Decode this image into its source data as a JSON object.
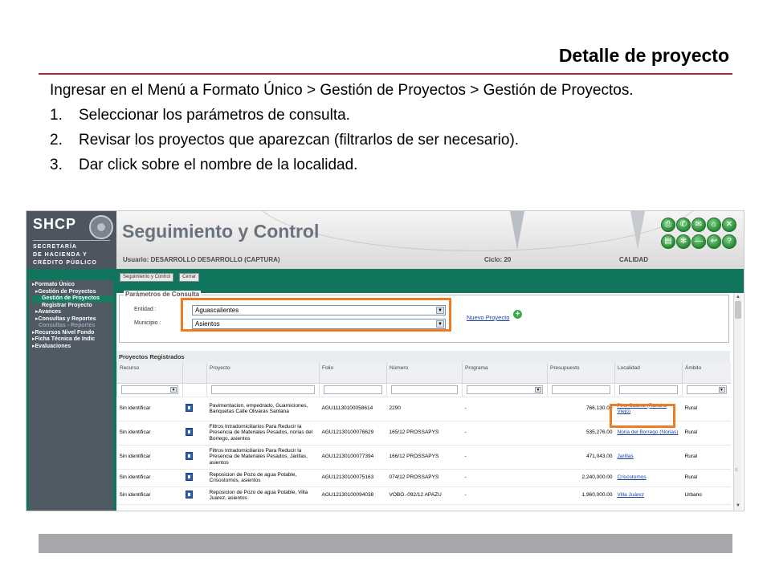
{
  "slide": {
    "title": "Detalle de proyecto",
    "intro": "Ingresar en el Menú a Formato Único > Gestión de Proyectos > Gestión de Proyectos.",
    "steps": [
      {
        "num": "1.",
        "text": "Seleccionar los parámetros de consulta."
      },
      {
        "num": "2.",
        "text": "Revisar los proyectos que aparezcan (filtrarlos de ser necesario)."
      },
      {
        "num": "3.",
        "text": "Dar click sobre el nombre de la localidad."
      }
    ]
  },
  "app": {
    "logo": "SHCP",
    "org_line1": "SECRETARÍA",
    "org_line2": "DE HACIENDA Y",
    "org_line3": "CRÉDITO PÚBLICO",
    "title": "Seguimiento y Control",
    "user": "Usuario: DESARROLLO DESARROLLO (CAPTURA)",
    "cycle": "Ciclo: 20",
    "quality": "CALIDAD",
    "header_icons": [
      "print-icon",
      "phone-icon",
      "mail-icon",
      "home-icon",
      "close-icon",
      "folder-icon",
      "tools-icon",
      "minus-icon",
      "back-icon",
      "help-icon"
    ],
    "tabs": {
      "main": "Seguimiento y Control",
      "close": "Cerrar"
    }
  },
  "sidebar": {
    "items": [
      {
        "label": "Formato Único",
        "level": 0
      },
      {
        "label": "Gestión de Proyectos",
        "level": 1
      },
      {
        "label": "Gestión de Proyectos",
        "level": 2,
        "selected": true
      },
      {
        "label": "Registrar Proyecto",
        "level": 2
      },
      {
        "label": "Avances",
        "level": 1
      },
      {
        "label": "Consultas y Reportes",
        "level": 1
      },
      {
        "label": "Consultas - Reportes",
        "level": 1,
        "dim": true
      },
      {
        "label": "Recursos Nivel Fondo",
        "level": 0
      },
      {
        "label": "Ficha Técnica de Indic",
        "level": 0
      },
      {
        "label": "Evaluaciones",
        "level": 0
      }
    ]
  },
  "params": {
    "title": "Parámetros de Consulta",
    "entidad_label": "Entidad :",
    "entidad_value": "Aguascalientes",
    "municipio_label": "Municipio :",
    "municipio_value": "Asientos",
    "new_project": "Nuevo Proyecto",
    "plus": "+"
  },
  "projects": {
    "title": "Proyectos Registrados",
    "columns": [
      "Recurso",
      "",
      "Proyecto",
      "Folio",
      "Número",
      "Programa",
      "Presupuesto",
      "Localidad",
      "Ámbito"
    ],
    "rows": [
      {
        "recurso": "Sin identificar",
        "proyecto": "Pavimentacion, empedrado, Guarniciones, Banquetas Calle Olivaras Santana",
        "folio": "AGU11130100058614",
        "numero": "2290",
        "programa": "-",
        "presupuesto": "766,130.00",
        "localidad": "Pino Suárez (Rancho Viejo)",
        "ambito": "Rural"
      },
      {
        "recurso": "Sin identificar",
        "proyecto": "Filtros Intradomiciliarios Para Reducir la Presencia de Materiales Pesados, norias del Borrego, asientos",
        "folio": "AGU12130100076629",
        "numero": "165/12 PROSSAPYS",
        "programa": "-",
        "presupuesto": "535,276.00",
        "localidad": "Noria del Borrego (Norias)",
        "ambito": "Rural"
      },
      {
        "recurso": "Sin identificar",
        "proyecto": "Filtros Intradomiciliarios Para Reducir la Presencia de Materiales Pesados, Jarillas, asientos",
        "folio": "AGU12130100077394",
        "numero": "166/12 PROSSAPYS",
        "programa": "-",
        "presupuesto": "471,043.00",
        "localidad": "Jarillas",
        "ambito": "Rural"
      },
      {
        "recurso": "Sin identificar",
        "proyecto": "Reposicion de Pozo de agua Potable, Crisostomos, asientos",
        "folio": "AGU12130100075163",
        "numero": "074/12 PROSSAPYS",
        "programa": "-",
        "presupuesto": "2,240,000.00",
        "localidad": "Crisóstomos",
        "ambito": "Rural"
      },
      {
        "recurso": "Sin identificar",
        "proyecto": "Reposicion de Pozo de agua Potable, Villa Juarez, asientos",
        "folio": "AGU12130100094038",
        "numero": "VOBO.-092/12 APAZU",
        "programa": "-",
        "presupuesto": "1,960,000.00",
        "localidad": "Villa Juárez",
        "ambito": "Urbano"
      }
    ]
  },
  "colors": {
    "accent_rule": "#b3243a",
    "highlight": "#ef7b22",
    "app_green": "#11755d",
    "footer": "#a7a7ab"
  }
}
